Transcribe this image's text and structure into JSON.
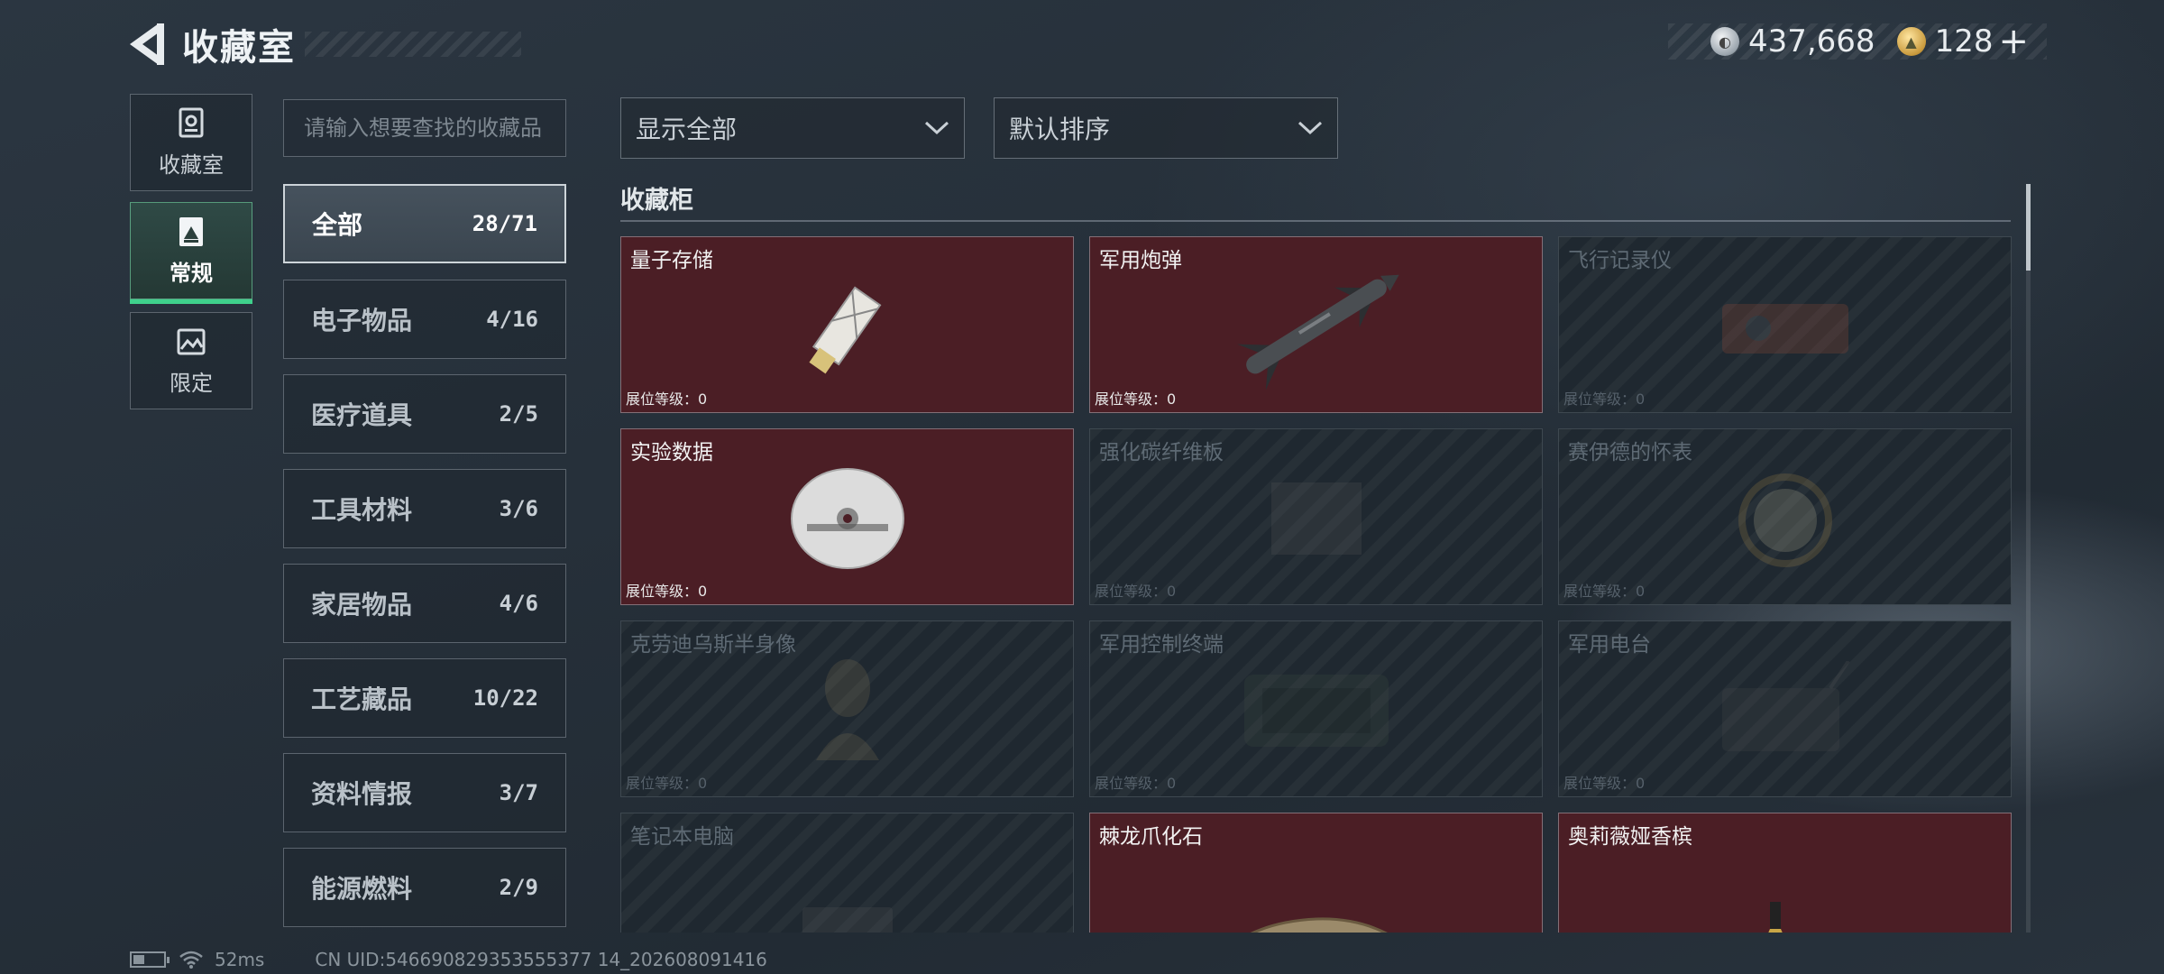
{
  "header": {
    "title": "收藏室"
  },
  "currency": {
    "silver": "437,668",
    "gold": "128",
    "plus": "+"
  },
  "nav": [
    {
      "label": "收藏室",
      "icon": "trophy-icon"
    },
    {
      "label": "常规",
      "icon": "document-icon"
    },
    {
      "label": "限定",
      "icon": "image-icon"
    }
  ],
  "search": {
    "placeholder": "请输入想要查找的收藏品"
  },
  "categories": [
    {
      "name": "全部",
      "count": "28/71"
    },
    {
      "name": "电子物品",
      "count": "4/16"
    },
    {
      "name": "医疗道具",
      "count": "2/5"
    },
    {
      "name": "工具材料",
      "count": "3/6"
    },
    {
      "name": "家居物品",
      "count": "4/6"
    },
    {
      "name": "工艺藏品",
      "count": "10/22"
    },
    {
      "name": "资料情报",
      "count": "3/7"
    },
    {
      "name": "能源燃料",
      "count": "2/9"
    }
  ],
  "filters": {
    "display": "显示全部",
    "sort": "默认排序"
  },
  "section": {
    "title": "收藏柜"
  },
  "items": [
    {
      "name": "量子存储",
      "level": "展位等级：0",
      "owned": true
    },
    {
      "name": "军用炮弹",
      "level": "展位等级：0",
      "owned": true
    },
    {
      "name": "飞行记录仪",
      "level": "展位等级：0",
      "owned": false
    },
    {
      "name": "实验数据",
      "level": "展位等级：0",
      "owned": true
    },
    {
      "name": "强化碳纤维板",
      "level": "展位等级：0",
      "owned": false
    },
    {
      "name": "赛伊德的怀表",
      "level": "展位等级：0",
      "owned": false
    },
    {
      "name": "克劳迪乌斯半身像",
      "level": "展位等级：0",
      "owned": false
    },
    {
      "name": "军用控制终端",
      "level": "展位等级：0",
      "owned": false
    },
    {
      "name": "军用电台",
      "level": "展位等级：0",
      "owned": false
    },
    {
      "name": "笔记本电脑",
      "level": "",
      "owned": false
    },
    {
      "name": "棘龙爪化石",
      "level": "",
      "owned": true
    },
    {
      "name": "奥莉薇娅香槟",
      "level": "",
      "owned": true
    }
  ],
  "status": {
    "ping": "52ms",
    "uid": "CN UID:546690829353555377 14_202608091416"
  }
}
